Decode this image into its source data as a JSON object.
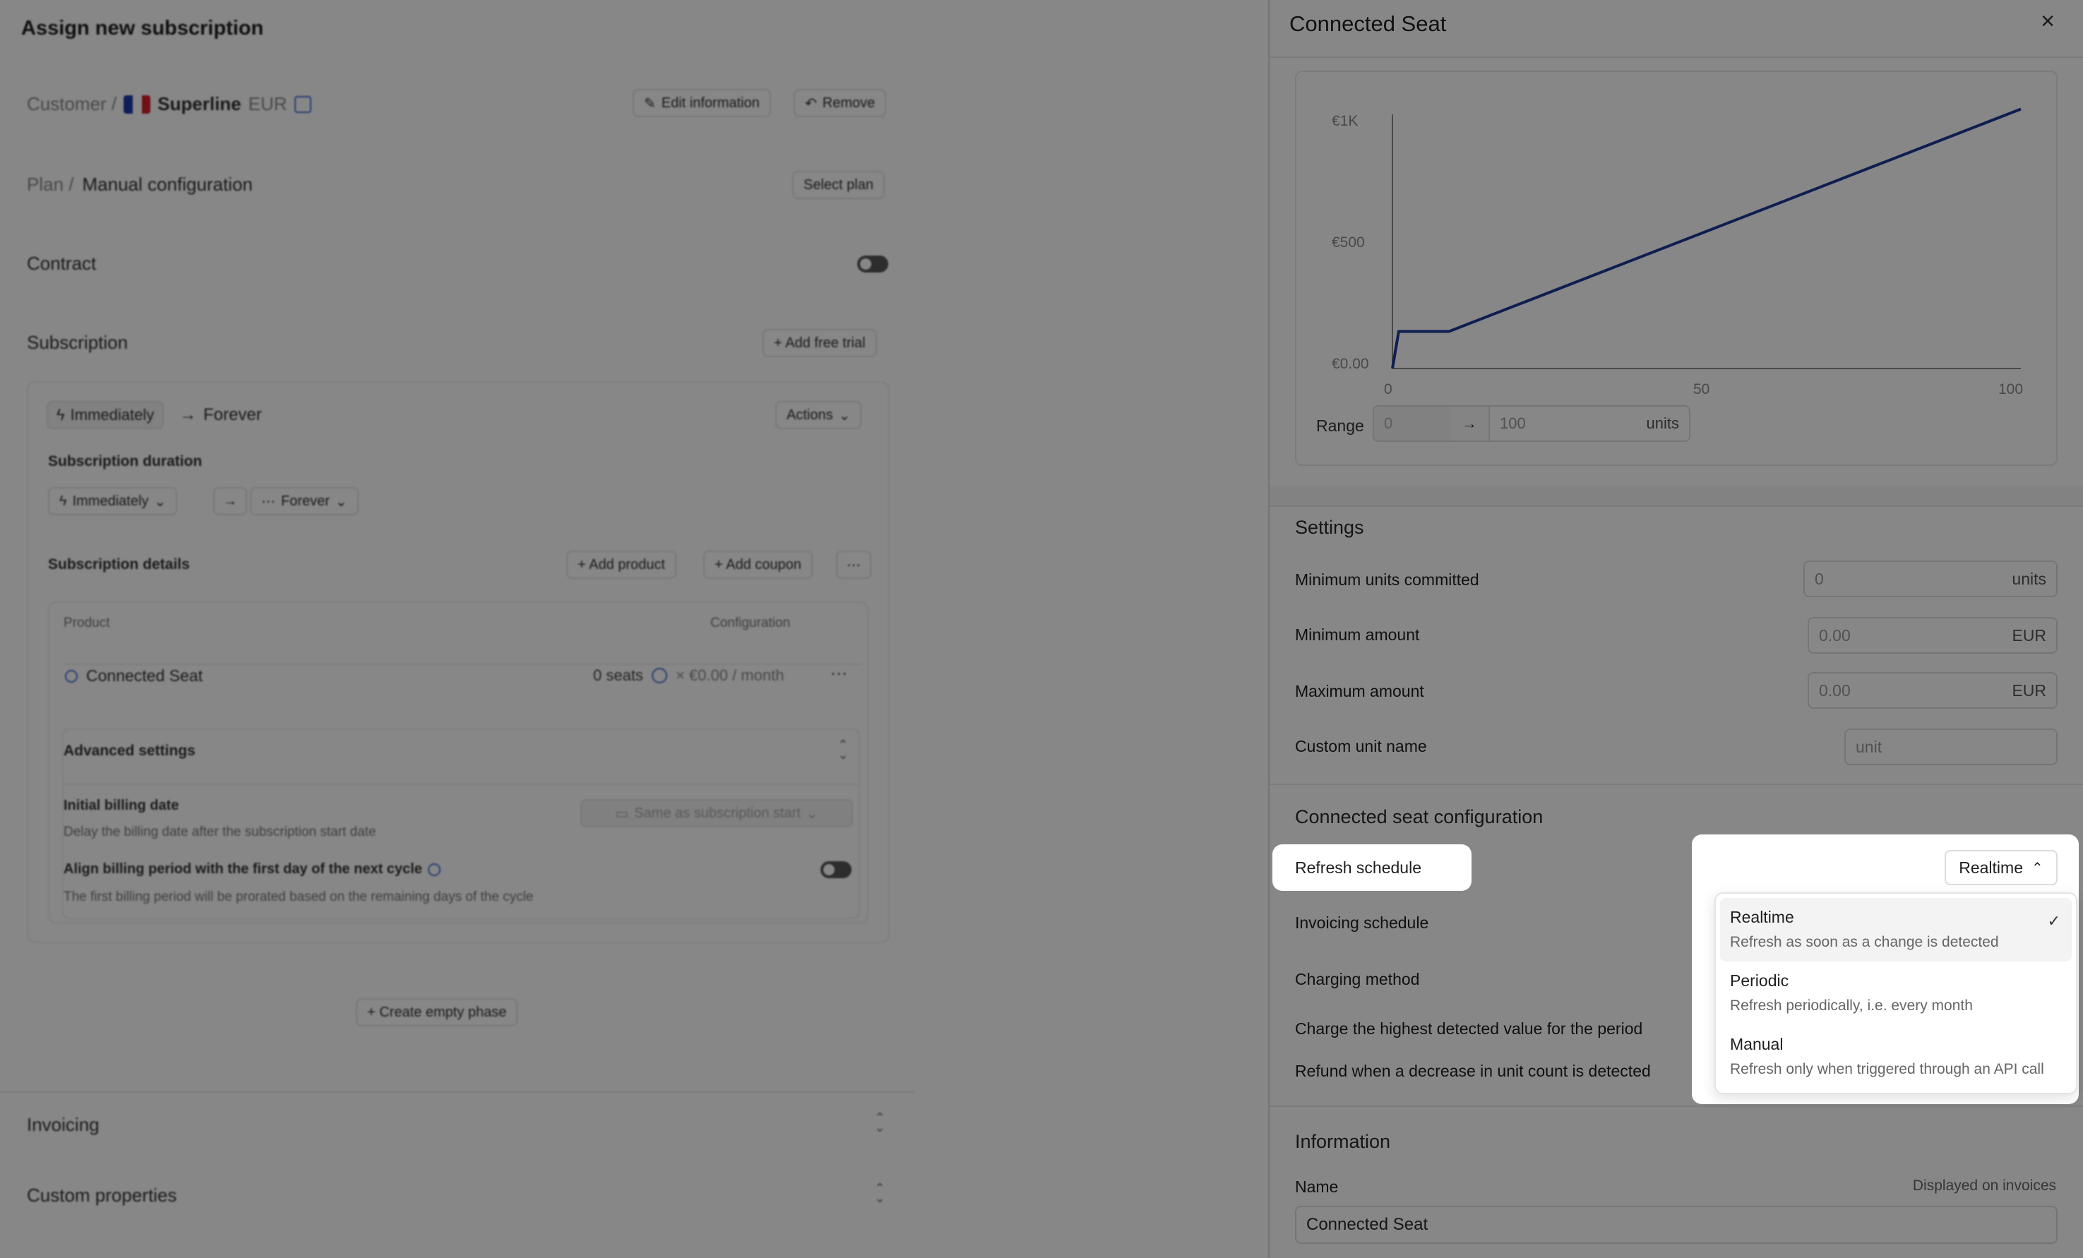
{
  "background_page": {
    "title": "Assign new subscription",
    "customer": {
      "label": "Customer /",
      "name": "Superline",
      "currency": "EUR",
      "edit_label": "Edit information",
      "remove_label": "Remove"
    },
    "plan": {
      "label": "Plan /",
      "value": "Manual configuration",
      "select_label": "Select plan"
    },
    "contract_label": "Contract",
    "subscription": {
      "label": "Subscription",
      "add_trial_label": "+ Add free trial",
      "start": "Immediately",
      "end": "Forever",
      "actions_label": "Actions",
      "duration_label": "Subscription duration",
      "duration_start": "Immediately",
      "duration_end": "Forever",
      "details_label": "Subscription details",
      "add_product_label": "+ Add product",
      "add_coupon_label": "+ Add coupon",
      "table_headers": [
        "Product",
        "Configuration"
      ],
      "product_name": "Connected Seat",
      "product_seats": "0 seats",
      "product_price": "× €0.00 / month",
      "advanced_label": "Advanced settings",
      "initial_billing_label": "Initial billing date",
      "initial_billing_desc": "Delay the billing date after the subscription start date",
      "initial_billing_value": "Same as subscription start",
      "align_label": "Align billing period with the first day of the next cycle",
      "align_desc": "The first billing period will be prorated based on the remaining days of the cycle",
      "create_phase_label": "+ Create empty phase"
    },
    "invoicing_label": "Invoicing",
    "custom_properties_label": "Custom properties"
  },
  "panel": {
    "title": "Connected Seat",
    "chart": {
      "y_ticks": [
        "€1K",
        "€500",
        "€0.00"
      ],
      "x_ticks": [
        "0",
        "50",
        "100"
      ]
    },
    "range": {
      "label": "Range",
      "from_placeholder": "0",
      "to_value": "100",
      "unit": "units"
    },
    "settings": {
      "heading": "Settings",
      "min_units_label": "Minimum units committed",
      "min_units_placeholder": "0",
      "min_units_unit": "units",
      "min_amount_label": "Minimum amount",
      "min_amount_placeholder": "0.00",
      "min_amount_unit": "EUR",
      "max_amount_label": "Maximum amount",
      "max_amount_placeholder": "0.00",
      "max_amount_unit": "EUR",
      "unit_name_label": "Custom unit name",
      "unit_name_placeholder": "unit"
    },
    "seat_config": {
      "heading": "Connected seat configuration",
      "refresh_label": "Refresh schedule",
      "refresh_value": "Realtime",
      "invoicing_label": "Invoicing schedule",
      "charging_label": "Charging method",
      "highest_label": "Charge the highest detected value for the period",
      "refund_label": "Refund when a decrease in unit count is detected",
      "options": [
        {
          "title": "Realtime",
          "desc": "Refresh as soon as a change is detected"
        },
        {
          "title": "Periodic",
          "desc": "Refresh periodically, i.e. every month"
        },
        {
          "title": "Manual",
          "desc": "Refresh only when triggered through an API call"
        }
      ]
    },
    "information": {
      "heading": "Information",
      "name_label": "Name",
      "name_hint": "Displayed on invoices",
      "name_value": "Connected Seat"
    }
  },
  "chart_data": {
    "type": "line",
    "x": [
      0,
      1,
      9,
      100
    ],
    "y": [
      0,
      150,
      150,
      1050
    ],
    "xlim": [
      0,
      100
    ],
    "ylim": [
      0,
      1000
    ],
    "y_tick_values": [
      1000,
      500,
      0
    ],
    "x_tick_values": [
      0,
      50,
      100
    ],
    "grid": false,
    "color": "#1e3a9a"
  },
  "colors": {
    "accent": "#1e3a9a",
    "overlay": "#000000"
  }
}
